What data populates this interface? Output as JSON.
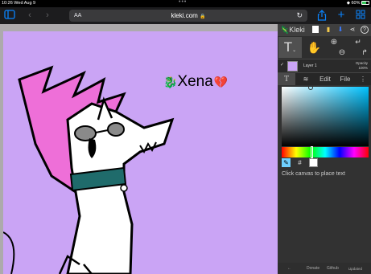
{
  "status": {
    "time": "10:26",
    "date": "Wed Aug 9",
    "dots": "•••",
    "battery": "60%"
  },
  "browser": {
    "text_size": "AA",
    "url": "kleki.com",
    "lock": "🔒",
    "reload": "↻"
  },
  "canvas": {
    "text": "Xena",
    "heart": "💔",
    "bg_color": "#caa4f5"
  },
  "panel": {
    "logo": "Kleki",
    "layer_name": "Layer 1",
    "opacity_label": "Opacity",
    "opacity_value": "100%",
    "tabs": [
      "T",
      "Edit",
      "File"
    ],
    "hint": "Click canvas to place text",
    "bottom": [
      "←",
      "Donate",
      "Github",
      "Updated"
    ],
    "bottom_extra": "..."
  },
  "colors": {
    "accent": "#0a84ff",
    "canvas_bg": "#caa4f5",
    "picker_hue": "#00c2ff"
  },
  "icons": {
    "sidebar": "sidebar-icon",
    "back": "chevron-left-icon",
    "forward": "chevron-right-icon",
    "share": "share-icon",
    "new_tab": "plus-icon",
    "tabs": "tabs-grid-icon",
    "text_tool": "text-tool-icon",
    "hand": "hand-icon",
    "zoom_in": "zoom-in-icon",
    "zoom_out": "zoom-out-icon",
    "undo": "undo-icon",
    "redo": "redo-icon",
    "layers": "layers-icon",
    "menu": "more-vertical-icon",
    "eyedropper": "eyedropper-icon"
  }
}
